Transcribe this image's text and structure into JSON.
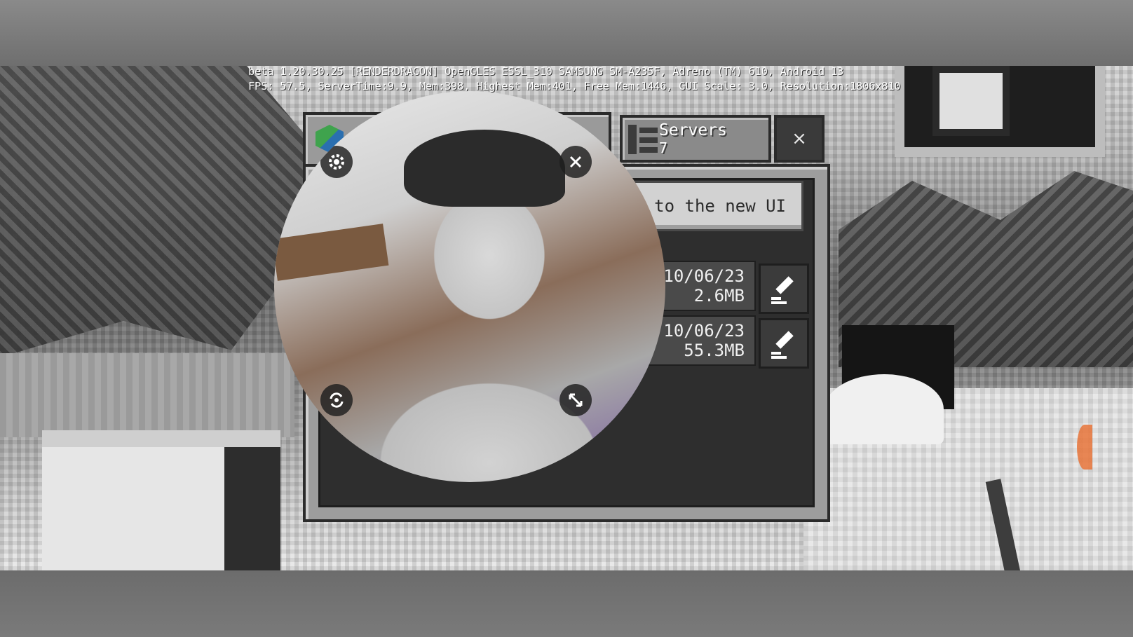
{
  "debug_overlay": {
    "line1": "beta 1.20.30.25 [RENDERDRAGON] OpenGLES ESSL_310 SAMSUNG SM-A235F, Adreno (TM) 610, Android 13",
    "line2": "FPS: 57.5, ServerTime:9.9, Mem:398, Highest Mem:401, Free Mem:1446, GUI Scale: 3.0, Resolution:1806x810"
  },
  "dialog": {
    "tab_servers": {
      "label": "Servers",
      "count": "7",
      "icon": "servers-icon"
    },
    "close_label": "×",
    "new_ui_button": "h to the new UI",
    "worlds": [
      {
        "date": "10/06/23",
        "size": "2.6MB"
      },
      {
        "date": "10/06/23",
        "size": "55.3MB"
      }
    ]
  },
  "camera_bubble": {
    "icons": [
      "gear-icon",
      "close-icon",
      "switch-camera-icon",
      "resize-icon"
    ]
  },
  "colors": {
    "panel": "#9d9d9d",
    "panel_dark": "#2e2e2e",
    "button_light": "#d2d2d2"
  }
}
